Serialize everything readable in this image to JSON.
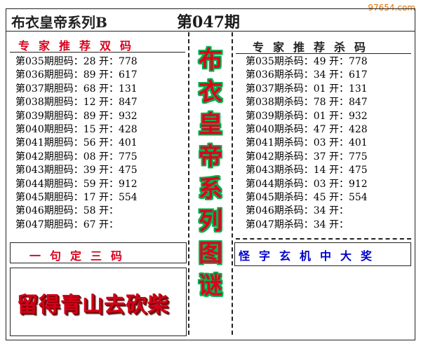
{
  "watermark": "97654.com",
  "header": {
    "title": "布衣皇帝系列B",
    "issue": "第047期"
  },
  "left": {
    "heading": "专家推荐双码",
    "rows": [
      "第035期胆码：28 开：778",
      "第036期胆码：89 开：617",
      "第037期胆码：68 开：131",
      "第038期胆码：12 开：847",
      "第039期胆码：89 开：932",
      "第040期胆码：15 开：428",
      "第041期胆码：56 开：401",
      "第042期胆码：08 开：775",
      "第043期胆码：39 开：475",
      "第044期胆码：59 开：912",
      "第045期胆码：17 开：554",
      "第046期胆码：58 开：",
      "第047期胆码：67 开："
    ],
    "bottom_heading": "一句定三码",
    "slogan": "留得青山去砍柴"
  },
  "right": {
    "heading": "专家推荐杀码",
    "rows": [
      "第035期杀码：49 开：778",
      "第036期杀码：34 开：617",
      "第037期杀码：01 开：131",
      "第038期杀码：78 开：847",
      "第039期杀码：01 开：932",
      "第040期杀码：47 开：428",
      "第041期杀码：03 开：401",
      "第042期杀码：37 开：775",
      "第043期杀码：14 开：475",
      "第044期杀码：03 开：912",
      "第045期杀码：45 开：554",
      "第046期杀码：34 开：",
      "第047期杀码：34 开："
    ],
    "bottom_heading": "怪字玄机中大奖"
  },
  "center": {
    "chars": [
      "布",
      "衣",
      "皇",
      "帝",
      "系",
      "列",
      "图",
      "谜"
    ]
  }
}
